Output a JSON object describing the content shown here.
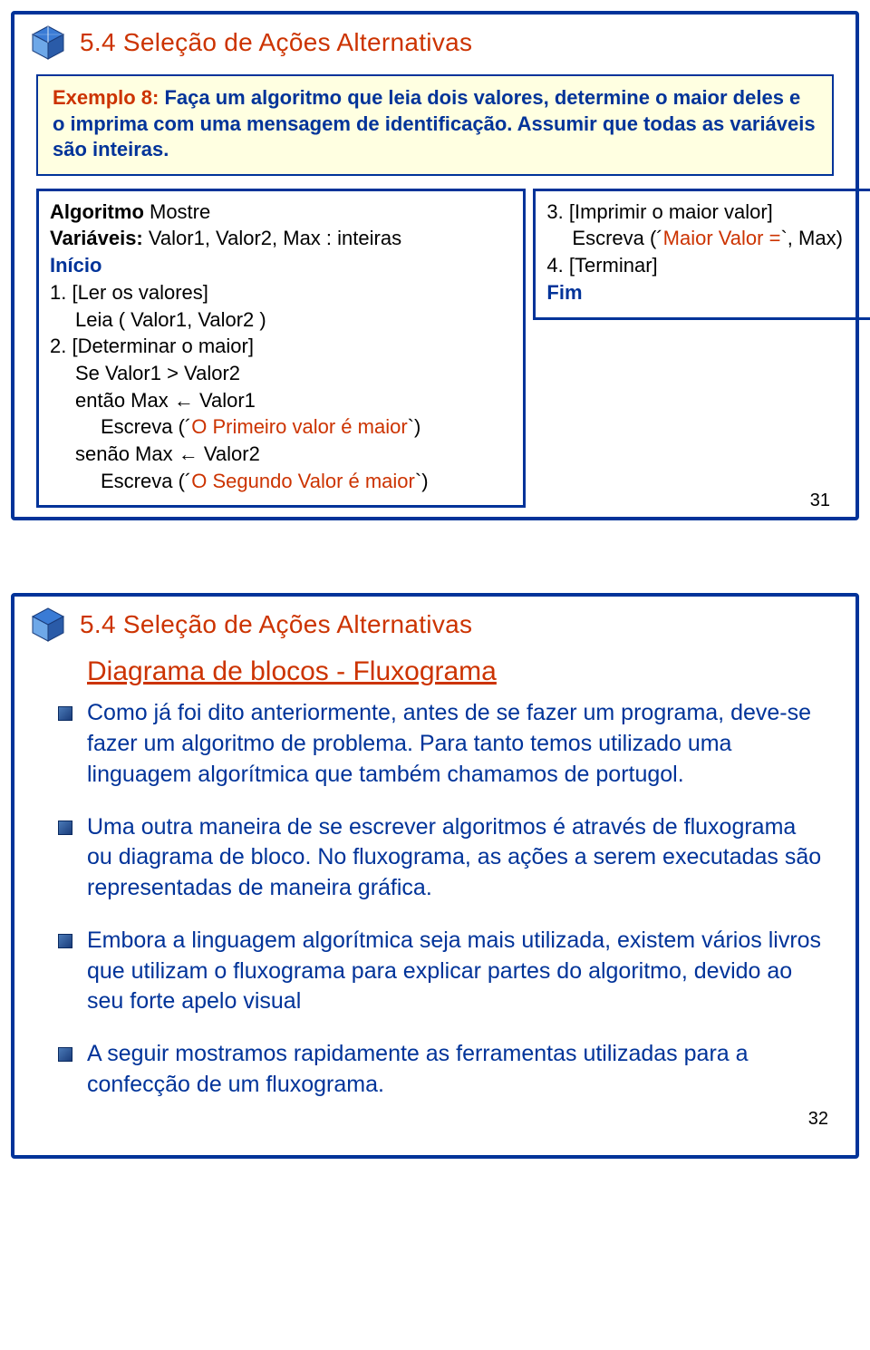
{
  "slide1": {
    "title": "5.4 Seleção de Ações Alternativas",
    "example": {
      "label": "Exemplo 8:",
      "text": " Faça um algoritmo que leia dois valores, determine o maior deles e o imprima com uma mensagem de identificação. Assumir que todas as variáveis são inteiras."
    },
    "code_left": {
      "l1a": "Algoritmo ",
      "l1b": "Mostre",
      "l2a": "Variáveis: ",
      "l2b": "Valor1, Valor2, Max : inteiras",
      "l3": "Início",
      "l4": "1. [Ler os valores]",
      "l5": "Leia ( Valor1, Valor2 )",
      "l6": "2. [Determinar o maior]",
      "l7": "Se Valor1 > Valor2",
      "l8pre": "então Max ",
      "l8arrow": "←",
      "l8post": " Valor1",
      "l9pre": "Escreva (´",
      "l9red": "O Primeiro valor é maior",
      "l9post": "`)",
      "l10pre": "senão Max ",
      "l10arrow": "←",
      "l10post": " Valor2",
      "l11pre": "Escreva (´",
      "l11red": "O Segundo Valor é maior",
      "l11post": "`)"
    },
    "code_right": {
      "r1": "3. [Imprimir o maior valor]",
      "r2pre": "Escreva (´",
      "r2red": "Maior Valor =",
      "r2post": "`, Max)",
      "r3": "4. [Terminar]",
      "r4": "Fim"
    },
    "page": "31"
  },
  "slide2": {
    "title": "5.4 Seleção de Ações Alternativas",
    "subhead": "Diagrama de blocos - Fluxograma",
    "bullets": [
      "Como já foi dito anteriormente, antes de se fazer um programa, deve-se fazer um algoritmo de problema. Para tanto temos utilizado uma linguagem algorítmica que também chamamos  de portugol.",
      "Uma outra maneira de se escrever algoritmos é através de fluxograma ou diagrama de bloco.  No  fluxograma,  as  ações a serem executadas são representadas de maneira gráfica.",
      "Embora a linguagem algorítmica seja mais utilizada, existem vários livros que utilizam o fluxograma para explicar partes do algoritmo, devido ao seu forte apelo visual",
      "A seguir mostramos rapidamente as ferramentas utilizadas para  a confecção de um fluxograma."
    ],
    "page": "32"
  }
}
